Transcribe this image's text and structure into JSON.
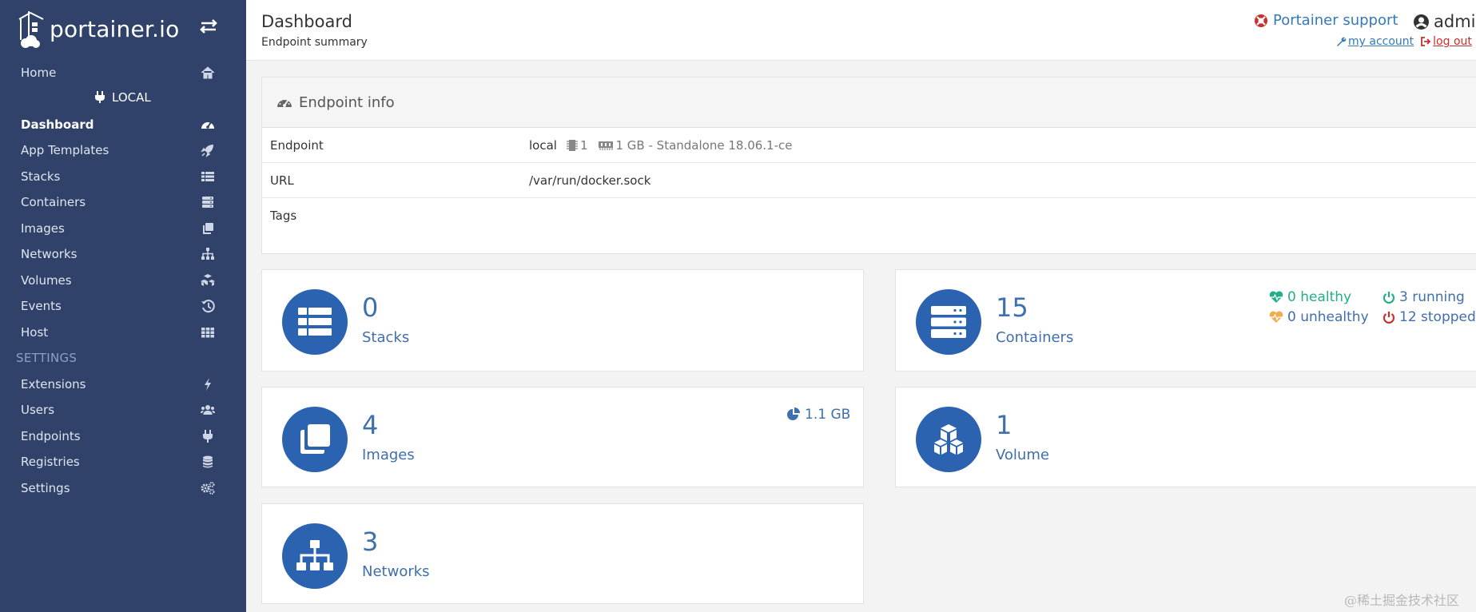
{
  "brand": {
    "name": "portainer.io"
  },
  "sidebar": {
    "endpoint_name": "LOCAL",
    "section_settings": "SETTINGS",
    "items": [
      {
        "label": "Home",
        "icon": "home-icon"
      },
      {
        "label": "Dashboard",
        "icon": "dashboard-icon",
        "active": true
      },
      {
        "label": "App Templates",
        "icon": "rocket-icon"
      },
      {
        "label": "Stacks",
        "icon": "list-icon"
      },
      {
        "label": "Containers",
        "icon": "server-icon"
      },
      {
        "label": "Images",
        "icon": "clone-icon"
      },
      {
        "label": "Networks",
        "icon": "sitemap-icon"
      },
      {
        "label": "Volumes",
        "icon": "cubes-icon"
      },
      {
        "label": "Events",
        "icon": "history-icon"
      },
      {
        "label": "Host",
        "icon": "th-icon"
      },
      {
        "label": "Extensions",
        "icon": "bolt-icon"
      },
      {
        "label": "Users",
        "icon": "users-icon"
      },
      {
        "label": "Endpoints",
        "icon": "plug-icon"
      },
      {
        "label": "Registries",
        "icon": "database-icon"
      },
      {
        "label": "Settings",
        "icon": "cogs-icon"
      }
    ]
  },
  "header": {
    "title": "Dashboard",
    "subtitle": "Endpoint summary",
    "support_label": "Portainer support",
    "username": "admin",
    "my_account": "my account",
    "log_out": "log out"
  },
  "endpoint_info": {
    "title": "Endpoint info",
    "rows": {
      "endpoint": {
        "key": "Endpoint",
        "name": "local",
        "cpu": "1",
        "memory_info": "1 GB - Standalone 18.06.1-ce"
      },
      "url": {
        "key": "URL",
        "value": "/var/run/docker.sock"
      },
      "tags": {
        "key": "Tags",
        "value": ""
      }
    }
  },
  "tiles": {
    "stacks": {
      "count": "0",
      "label": "Stacks"
    },
    "containers": {
      "count": "15",
      "label": "Containers",
      "healthy": "0 healthy",
      "unhealthy": "0 unhealthy",
      "running": "3 running",
      "stopped": "12 stopped"
    },
    "images": {
      "count": "4",
      "label": "Images",
      "size": "1.1 GB"
    },
    "volumes": {
      "count": "1",
      "label": "Volume"
    },
    "networks": {
      "count": "3",
      "label": "Networks"
    }
  },
  "colors": {
    "sidebar": "#30426a",
    "accent": "#2b63b0",
    "healthy": "#23ae89",
    "unhealthy": "#f0ad4e",
    "stopped": "#c9302c"
  },
  "watermark": "@稀土掘金技术社区"
}
